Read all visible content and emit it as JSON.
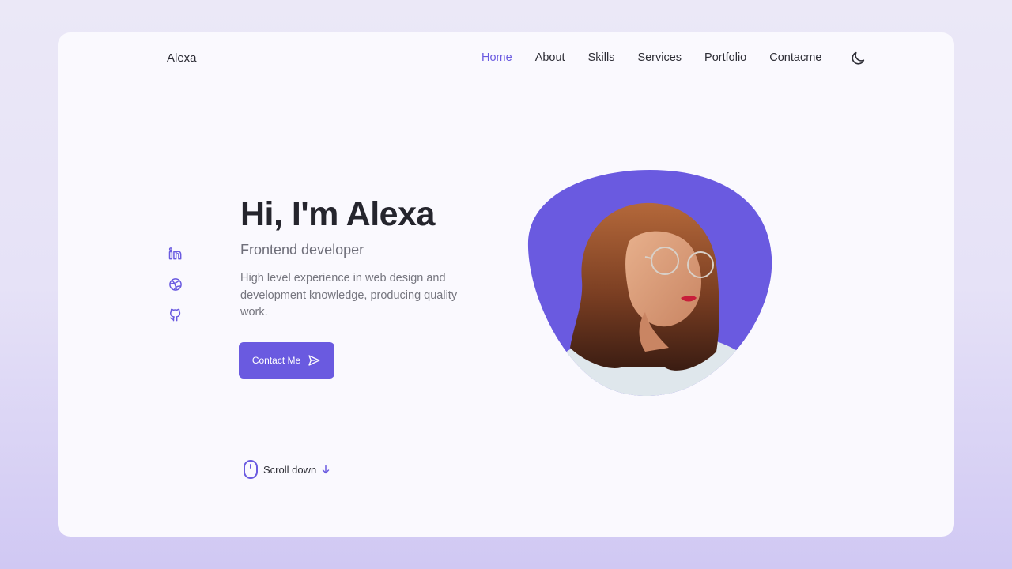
{
  "header": {
    "logo": "Alexa",
    "nav": [
      {
        "label": "Home",
        "active": true
      },
      {
        "label": "About",
        "active": false
      },
      {
        "label": "Skills",
        "active": false
      },
      {
        "label": "Services",
        "active": false
      },
      {
        "label": "Portfolio",
        "active": false
      },
      {
        "label": "Contacme",
        "active": false
      }
    ],
    "theme_icon": "moon-icon"
  },
  "social": [
    {
      "name": "linkedin",
      "icon": "linkedin-icon"
    },
    {
      "name": "dribbble",
      "icon": "dribbble-icon"
    },
    {
      "name": "github",
      "icon": "github-icon"
    }
  ],
  "hero": {
    "title": "Hi, I'm Alexa",
    "subtitle": "Frontend developer",
    "description": "High level experience in web design and development knowledge, producing quality work.",
    "cta_label": "Contact Me",
    "cta_icon": "send-icon",
    "portrait_alt": "Portrait of Alexa"
  },
  "scroll": {
    "label": "Scroll down",
    "icon": "mouse-icon",
    "arrow_icon": "arrow-down-icon"
  },
  "colors": {
    "accent": "#6a5ae0",
    "text_dark": "#25252d",
    "card_bg": "#faf9fe"
  }
}
